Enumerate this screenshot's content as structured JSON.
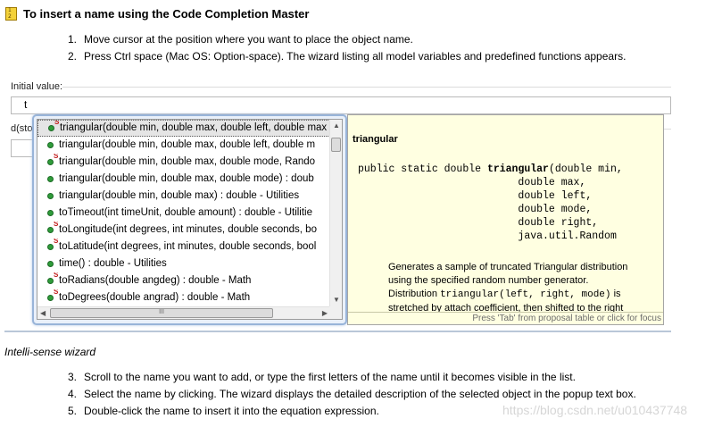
{
  "heading": {
    "text": "To insert a name using the Code Completion Master",
    "icon": "steps-icon"
  },
  "steps_top": [
    {
      "num": "1.",
      "text": "Move cursor at the position where you want to place the object name."
    },
    {
      "num": "2.",
      "text": "Press Ctrl space (Mac OS: Option-space). The wizard listing all model variables and predefined functions appears."
    }
  ],
  "form": {
    "initial_label": "Initial value:",
    "initial_value": "t",
    "second_label": "d(sto"
  },
  "completion_list": {
    "items": [
      {
        "text": "triangular(double min, double max, double left, double max",
        "static": true,
        "selected": true
      },
      {
        "text": "triangular(double min, double max, double left, double m",
        "static": false,
        "selected": false
      },
      {
        "text": "triangular(double min, double max, double mode, Rando",
        "static": true,
        "selected": false
      },
      {
        "text": "triangular(double min, double max, double mode) : doub",
        "static": false,
        "selected": false
      },
      {
        "text": "triangular(double min, double max) : double - Utilities",
        "static": false,
        "selected": false
      },
      {
        "text": "toTimeout(int timeUnit, double amount) : double - Utilitie",
        "static": false,
        "selected": false
      },
      {
        "text": "toLongitude(int degrees, int minutes, double seconds, bo",
        "static": true,
        "selected": false
      },
      {
        "text": "toLatitude(int degrees, int minutes, double seconds, bool",
        "static": true,
        "selected": false
      },
      {
        "text": "time() : double - Utilities",
        "static": false,
        "selected": false
      },
      {
        "text": "toRadians(double angdeg) : double - Math",
        "static": true,
        "selected": false
      },
      {
        "text": "toDegrees(double angrad) : double - Math",
        "static": true,
        "selected": false
      }
    ],
    "static_marker": "S",
    "hscroll_grip": "III"
  },
  "detail": {
    "title": "triangular",
    "sig_prefix": "public static double ",
    "sig_name": "triangular",
    "sig_rest": "(double min,\n                          double max,\n                          double left,\n                          double mode,\n                          double right,\n                          java.util.Random",
    "desc_line1": "Generates a sample of truncated Triangular distribution",
    "desc_line2": "using the specified random number generator.",
    "desc_line3a": "Distribution ",
    "desc_line3code": "triangular(left, right, mode)",
    "desc_line3b": " is",
    "desc_line4": "stretched by attach coefficient, then shifted to the right",
    "footer": "Press 'Tab' from proposal table or click for focus"
  },
  "caption": "Intelli-sense wizard",
  "steps_bottom": [
    {
      "num": "3.",
      "text": "Scroll to the name you want to add, or type the first letters of the name until it becomes visible in the list."
    },
    {
      "num": "4.",
      "text": "Select the name by clicking. The wizard displays the detailed description of the selected object in the popup text box."
    },
    {
      "num": "5.",
      "text": "Double-click the name to insert it into the equation expression."
    }
  ],
  "watermark": "https://blog.csdn.net/u010437748",
  "colors": {
    "popup_border": "#98b4d9",
    "detail_bg": "#ffffe1",
    "method_icon": "#2f9c3a",
    "static_marker": "#c01818"
  }
}
